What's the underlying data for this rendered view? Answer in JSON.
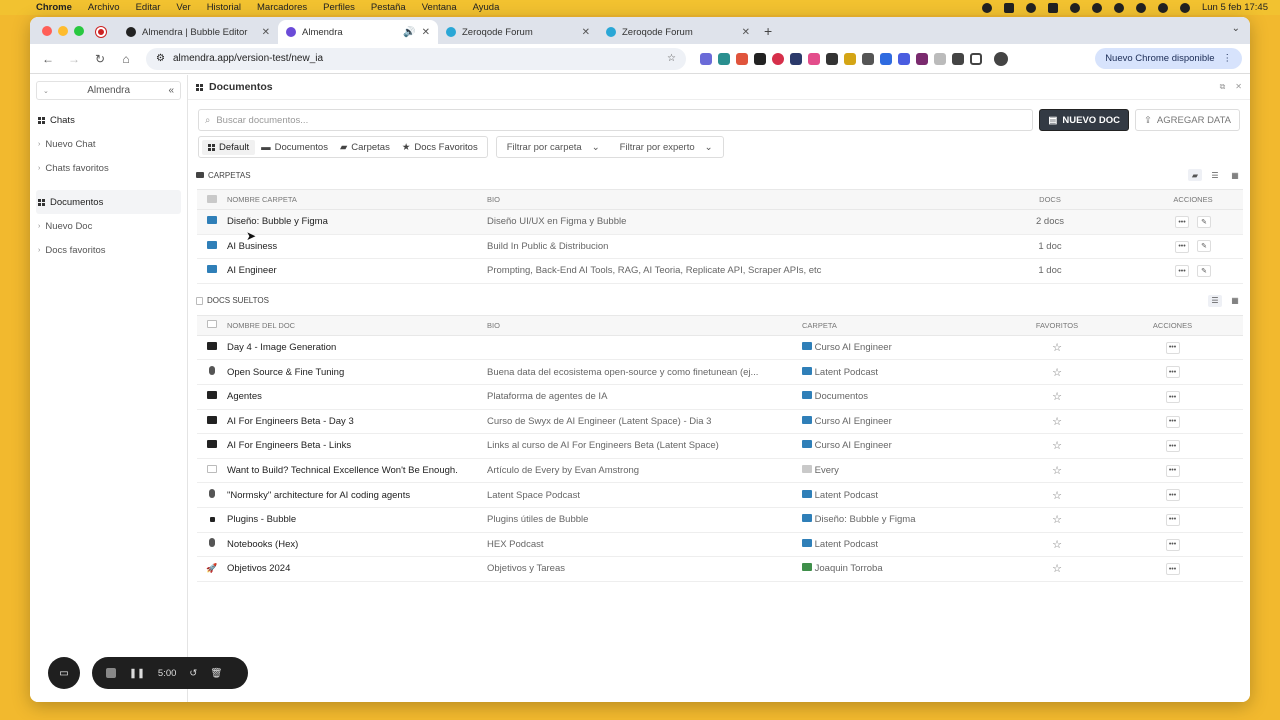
{
  "menubar": {
    "app": "Chrome",
    "items": [
      "Archivo",
      "Editar",
      "Ver",
      "Historial",
      "Marcadores",
      "Perfiles",
      "Pestaña",
      "Ventana",
      "Ayuda"
    ],
    "clock": "Lun 5 feb  17:45"
  },
  "browser": {
    "tabs": [
      {
        "title": "Almendra | Bubble Editor",
        "favicon_color": "#222222"
      },
      {
        "title": "Almendra",
        "favicon_color": "#6b4bd8"
      },
      {
        "title": "Zeroqode Forum",
        "favicon_color": "#2aa7d6"
      },
      {
        "title": "Zeroqode Forum",
        "favicon_color": "#2aa7d6"
      }
    ],
    "url": "almendra.app/version-test/new_ia",
    "new_chrome": "Nuevo Chrome disponible"
  },
  "sidebar": {
    "title": "Almendra",
    "groups": [
      {
        "label": "Chats",
        "items": [
          "Nuevo Chat",
          "Chats favoritos"
        ]
      },
      {
        "label": "Documentos",
        "items": [
          "Nuevo Doc",
          "Docs favoritos"
        ]
      }
    ]
  },
  "main": {
    "title": "Documentos",
    "search_placeholder": "Buscar documentos...",
    "new_doc": "NUEVO DOC",
    "add_data": "AGREGAR DATA",
    "views": [
      "Default",
      "Documentos",
      "Carpetas",
      "Docs Favoritos"
    ],
    "filters": [
      "Filtrar por carpeta",
      "Filtrar por experto"
    ]
  },
  "folders": {
    "section": "CARPETAS",
    "headers": [
      "NOMBRE CARPETA",
      "BIO",
      "DOCS",
      "ACCIONES"
    ],
    "rows": [
      {
        "name": "Diseño: Bubble y Figma",
        "bio": "Diseño UI/UX en Figma y Bubble",
        "docs": "2 docs"
      },
      {
        "name": "AI Business",
        "bio": "Build In Public & Distribucion",
        "docs": "1 doc"
      },
      {
        "name": "AI Engineer",
        "bio": "Prompting, Back-End AI Tools, RAG, AI Teoria, Replicate API, Scraper APIs, etc",
        "docs": "1 doc"
      }
    ]
  },
  "docs": {
    "section": "DOCS SUELTOS",
    "headers": [
      "NOMBRE DEL DOC",
      "BIO",
      "CARPETA",
      "FAVORITOS",
      "ACCIONES"
    ],
    "rows": [
      {
        "name": "Day 4 - Image Generation",
        "bio": "",
        "folder": "Curso AI Engineer",
        "icon": "screen",
        "folder_color": "blue"
      },
      {
        "name": "Open Source & Fine Tuning",
        "bio": "Buena data del ecosistema open-source y como finetunean (ej...",
        "folder": "Latent Podcast",
        "icon": "mic",
        "folder_color": "blue"
      },
      {
        "name": "Agentes",
        "bio": "Plataforma de agentes de IA",
        "folder": "Documentos",
        "icon": "screen",
        "folder_color": "blue"
      },
      {
        "name": "AI For Engineers Beta - Day 3",
        "bio": "Curso de Swyx de AI Engineer (Latent Space) - Dia 3",
        "folder": "Curso AI Engineer",
        "icon": "screen",
        "folder_color": "blue"
      },
      {
        "name": "AI For Engineers Beta - Links",
        "bio": "Links al curso de AI For Engineers Beta (Latent Space)",
        "folder": "Curso AI Engineer",
        "icon": "screen",
        "folder_color": "blue"
      },
      {
        "name": "Want to Build? Technical Excellence Won't Be Enough.",
        "bio": "Artículo de Every by Evan Amstrong",
        "folder": "Every",
        "icon": "paper",
        "folder_color": "gray"
      },
      {
        "name": "\"Normsky\" architecture for AI coding agents",
        "bio": "Latent Space Podcast",
        "folder": "Latent Podcast",
        "icon": "mic",
        "folder_color": "blue"
      },
      {
        "name": "Plugins - Bubble",
        "bio": "Plugins útiles de Bubble",
        "folder": "Diseño: Bubble y Figma",
        "icon": "dot",
        "folder_color": "blue"
      },
      {
        "name": "Notebooks (Hex)",
        "bio": "HEX Podcast",
        "folder": "Latent Podcast",
        "icon": "mic",
        "folder_color": "blue"
      },
      {
        "name": "Objetivos 2024",
        "bio": "Objetivos y Tareas",
        "folder": "Joaquin Torroba",
        "icon": "rocket",
        "folder_color": "green"
      }
    ]
  },
  "recorder": {
    "time": "5:00"
  }
}
